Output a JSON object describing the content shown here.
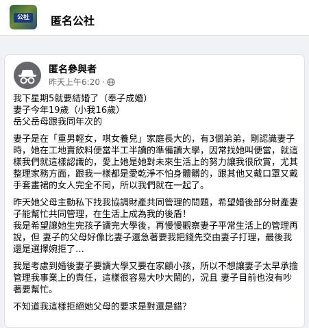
{
  "group": {
    "name": "匿名公社",
    "avatar_sign_text": "公社"
  },
  "post": {
    "author": "匿名參與者",
    "timestamp": "昨天上午6:20",
    "privacy_icon": "globe-icon",
    "paragraphs": [
      "我下星期5就要結婚了（奉子成婚）\n妻子今年19歲（小我16歲）\n岳父岳母跟我同年次的",
      "妻子是在「重男輕女，唭女養兒」家庭長大的，有3個弟弟，剛認識妻子時，她在工地賣飲料便當半工半讀的準備讀大學，因常找她叫便當，就這樣我們就這樣認識的，愛上她是她對未來生活上的努力讓我很欣賞，尤其整理家務方面，跟我一樣都是愛乾淨不怕身體髒的，跟其他又戴口罩又戴手套畫裙的女人完全不同，所以我們就在一起了。",
      "昨天她父母主動私下找我協調財產共同管理的問題，希望婚後部分財產妻子能幫忙共同管理，在生活上成為我的後盾！\n我是希望讓她生完孩子讀完大學後，再慢慢觀察妻子平常生活上的管理再說，但 妻子的父母好像比妻子還急著要我把錢先交由妻子打理，最後我還是選擇婉拒了…",
      "我是考慮到婚後妻子要讀大學又要在家顧小孩，所以不想讓妻子太早承擔管理我事業上的責任，這樣很容易大吵大鬧的，況且 妻子目前也沒有吵著要幫忙。",
      "不知道我這樣拒絕她父母的要求是對還是錯？"
    ]
  }
}
